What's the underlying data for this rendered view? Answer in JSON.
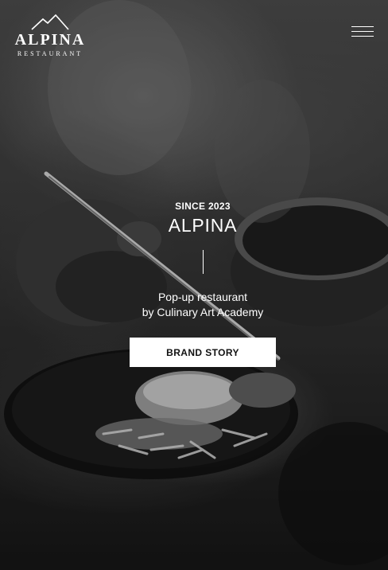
{
  "brand": {
    "name": "ALPINA",
    "subtitle": "RESTAURANT"
  },
  "nav": {
    "menu_icon": "hamburger-menu-icon"
  },
  "hero": {
    "eyebrow": "SINCE 2023",
    "title": "ALPINA",
    "tagline_line1": "Pop-up restaurant",
    "tagline_line2": "by Culinary Art Academy",
    "cta_label": "BRAND STORY",
    "image_description": "plating-hands-photo"
  },
  "colors": {
    "text": "#ffffff",
    "button_bg": "#ffffff",
    "button_text": "#111111"
  }
}
